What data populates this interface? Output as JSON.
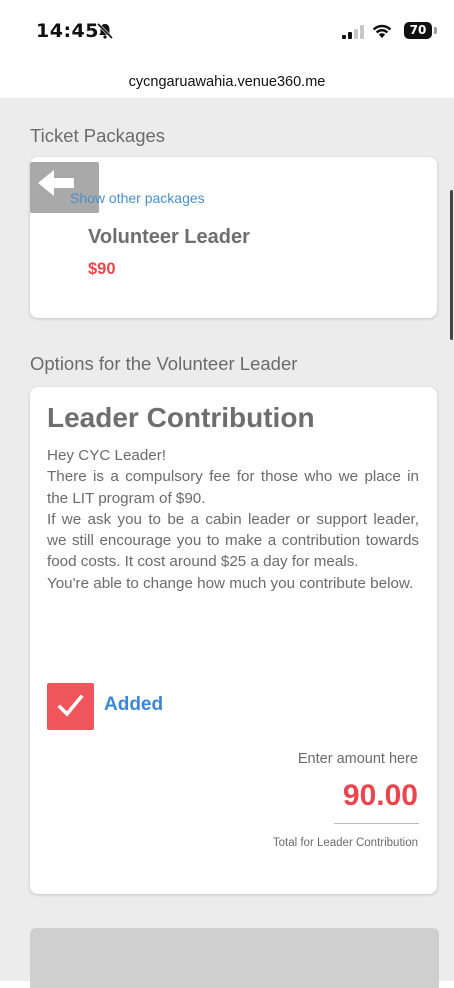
{
  "status_bar": {
    "time": "14:45",
    "battery": "70"
  },
  "browser": {
    "url": "cycngaruawahia.venue360.me"
  },
  "packages": {
    "section_title": "Ticket Packages",
    "show_other_label": "Show other packages",
    "selected_name": "Volunteer Leader",
    "selected_price": "$90"
  },
  "options": {
    "section_title": "Options for the Volunteer Leader",
    "title": "Leader Contribution",
    "description": [
      "Hey CYC Leader!",
      "There is a compulsory fee for those who we place in the LIT program of $90.",
      "If we ask you to be a cabin leader or support leader, we still encourage you to make a contribution towards food costs. It cost around $25 a day for meals.",
      "You're able to change how much you contribute below."
    ],
    "added_label": "Added",
    "amount_label": "Enter amount here",
    "amount_value": "90.00",
    "total_label": "Total for Leader Contribution"
  },
  "colors": {
    "accent_red": "#e8474f",
    "link_blue": "#4a8fc9",
    "added_blue": "#3b87d5"
  },
  "icons": {
    "back": "back-arrow-icon",
    "check": "checkmark-icon",
    "bell": "bell-slash-icon",
    "wifi": "wifi-icon",
    "signal": "signal-icon"
  }
}
